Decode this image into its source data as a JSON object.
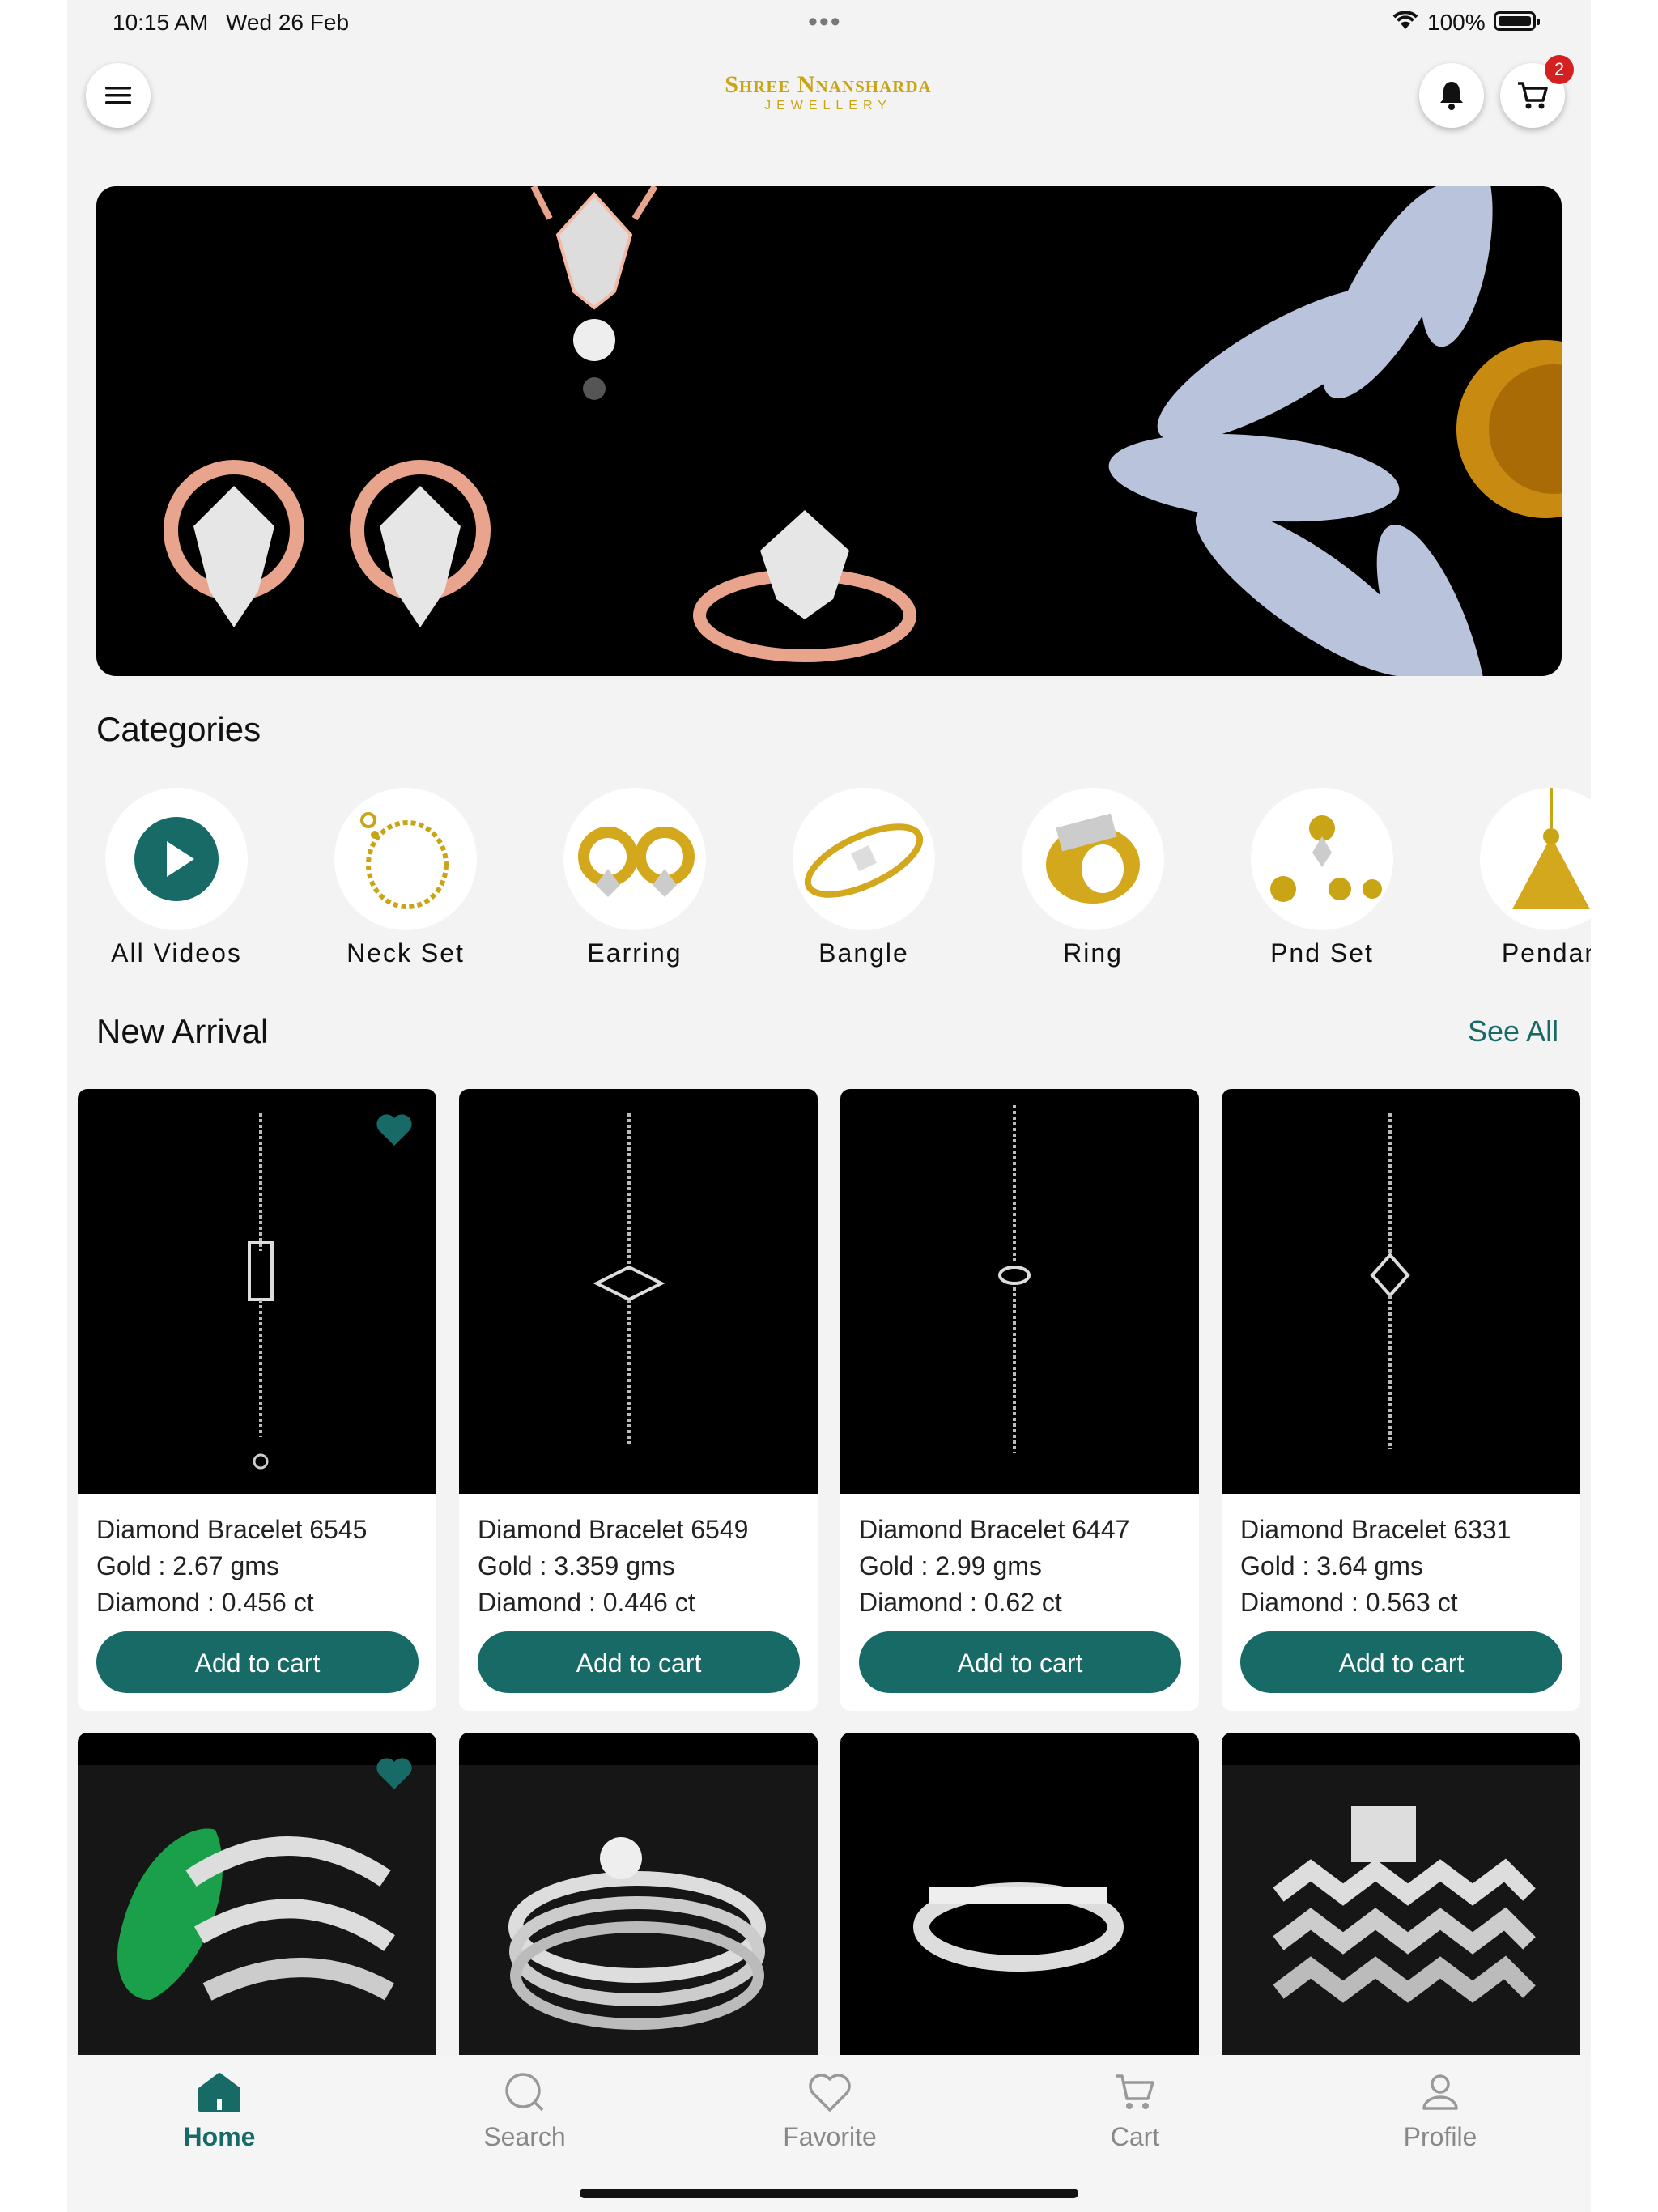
{
  "status_bar": {
    "time": "10:15 AM",
    "date": "Wed 26 Feb",
    "battery": "100%"
  },
  "header": {
    "logo_line1": "Shree Nnansharda",
    "logo_line2": "JEWELLERY",
    "cart_badge": "2"
  },
  "categories": {
    "title": "Categories",
    "items": [
      {
        "label": "All Videos"
      },
      {
        "label": "Neck Set"
      },
      {
        "label": "Earring"
      },
      {
        "label": "Bangle"
      },
      {
        "label": "Ring"
      },
      {
        "label": "Pnd Set"
      },
      {
        "label": "Pendan"
      }
    ]
  },
  "new_arrival": {
    "title": "New Arrival",
    "see_all": "See All",
    "products": [
      {
        "name": "Diamond Bracelet 6545",
        "gold": "Gold : 2.67 gms",
        "diamond": "Diamond : 0.456 ct",
        "button": "Add to cart",
        "favorite": true
      },
      {
        "name": "Diamond Bracelet 6549",
        "gold": "Gold : 3.359 gms",
        "diamond": "Diamond : 0.446 ct",
        "button": "Add to cart",
        "favorite": false
      },
      {
        "name": "Diamond Bracelet 6447",
        "gold": "Gold : 2.99 gms",
        "diamond": "Diamond : 0.62 ct",
        "button": "Add to cart",
        "favorite": false
      },
      {
        "name": "Diamond Bracelet 6331",
        "gold": "Gold : 3.64 gms",
        "diamond": "Diamond : 0.563 ct",
        "button": "Add to cart",
        "favorite": false
      }
    ]
  },
  "bottom_nav": {
    "items": [
      {
        "label": "Home",
        "icon": "home-icon",
        "active": true
      },
      {
        "label": "Search",
        "icon": "search-icon",
        "active": false
      },
      {
        "label": "Favorite",
        "icon": "heart-icon",
        "active": false
      },
      {
        "label": "Cart",
        "icon": "cart-icon",
        "active": false
      },
      {
        "label": "Profile",
        "icon": "profile-icon",
        "active": false
      }
    ]
  },
  "colors": {
    "accent": "#176a66",
    "logo_gold": "#c9a516",
    "badge_red": "#d42020",
    "background": "#f3f3f3"
  }
}
